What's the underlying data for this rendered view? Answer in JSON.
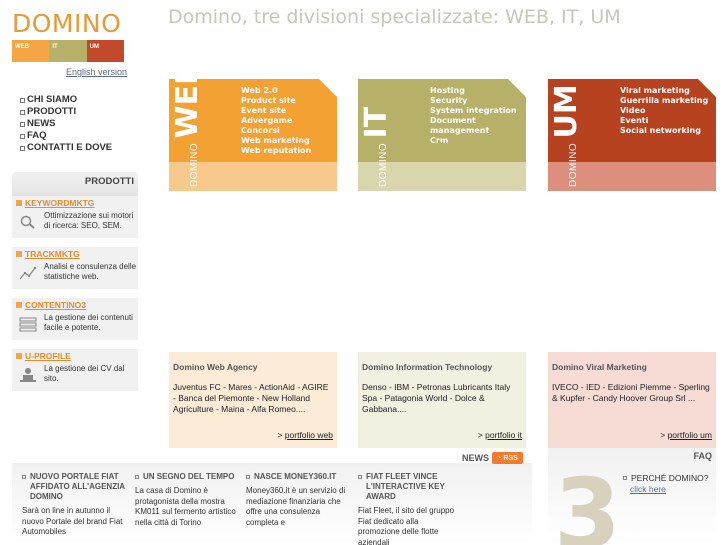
{
  "logo": {
    "word": "DOMINO",
    "bars": [
      {
        "label": "WEB",
        "color": "#f3a643"
      },
      {
        "label": "IT",
        "color": "#b7b068"
      },
      {
        "label": "UM",
        "color": "#c24a2a"
      }
    ]
  },
  "english_link": "English version",
  "headline": "Domino, tre divisioni specializzate: WEB, IT, UM",
  "nav": [
    "CHI SIAMO",
    "PRODOTTI",
    "NEWS",
    "FAQ",
    "CONTATTI E DOVE"
  ],
  "prodotti": {
    "title": "PRODOTTI",
    "items": [
      {
        "name": "KEYWORDMKTG",
        "desc": "Ottimizzazione sui motori di ricerca: SEO, SEM.",
        "icon": "magnifier-icon"
      },
      {
        "name": "TRACKMKTG",
        "desc": "Analisi e consulenza delle statistiche web.",
        "icon": "chart-icon"
      },
      {
        "name": "CONTENTINO3",
        "desc": "La gestione dei contenuti facile e potente.",
        "icon": "layers-icon"
      },
      {
        "name": "U-PROFILE",
        "desc": "La gestione dei CV dal sito.",
        "icon": "user-icon"
      }
    ]
  },
  "divisions": [
    {
      "small": "DOMINO",
      "big": "WEB",
      "color_top": "#f3a133",
      "color_bottom": "#f8c98c",
      "items": [
        "Web 2.0",
        "Product site",
        "Event site",
        "Advergame",
        "Concorsi",
        "Web marketing",
        "Web reputation"
      ]
    },
    {
      "small": "DOMINO",
      "big": "IT",
      "color_top": "#b7b068",
      "color_bottom": "#d9d6ae",
      "items": [
        "Hosting",
        "Security",
        "System integration",
        "Document management",
        "Crm"
      ]
    },
    {
      "small": "DOMINO",
      "big": "UM",
      "color_top": "#b6421f",
      "color_bottom": "#dc8f7d",
      "items": [
        "Viral marketing",
        "Guerrilla marketing",
        "Video",
        "Eventi",
        "Social networking"
      ]
    }
  ],
  "agencies": [
    {
      "title": "Domino Web Agency",
      "clients": "Juventus FC - Mares - ActionAid - AGIRE - Banca del Piemonte - New Holland Agriculture - Maina - Alfa Romeo....",
      "link": "portfolio web",
      "bg": "#fcebd6"
    },
    {
      "title": "Domino Information Technology",
      "clients": "Denso - IBM - Petronas Lubricants Italy Spa - Patagonia World - Dolce & Gabbana....",
      "link": "portfolio it",
      "bg": "#f2f0e1"
    },
    {
      "title": "Domino Viral Marketing",
      "clients": "IVECO - IED - Edizioni Piemme - Sperling & Kupfer - Candy Hoover Group Srl ...",
      "link": "portfolio um",
      "bg": "#f6dcd5"
    }
  ],
  "news": {
    "label": "NEWS",
    "rss": "RSS",
    "items": [
      {
        "title": "NUOVO PORTALE FIAT AFFIDATO ALL'AGENZIA DOMINO",
        "text": "Sarà on line in autunno il nuovo Portale del brand Fiat Automobiles"
      },
      {
        "title": "UN SEGNO DEL TEMPO",
        "text": "La casa di Domino è protagonista della mostra KM011 sul fermento artistico nella città di Torino"
      },
      {
        "title": "NASCE MONEY360.IT",
        "text": "Money360.it è un servizio di mediazione finanziaria che offre una consulenza completa e"
      },
      {
        "title": "FIAT FLEET VINCE L'INTERACTIVE KEY AWARD",
        "text": "Fiat Fleet, il sito del gruppo Fiat dedicato alla promozione delle flotte aziendali"
      }
    ]
  },
  "faq": {
    "label": "FAQ",
    "number": "3",
    "question": "PERCHÉ DOMINO?",
    "link": "click here"
  }
}
